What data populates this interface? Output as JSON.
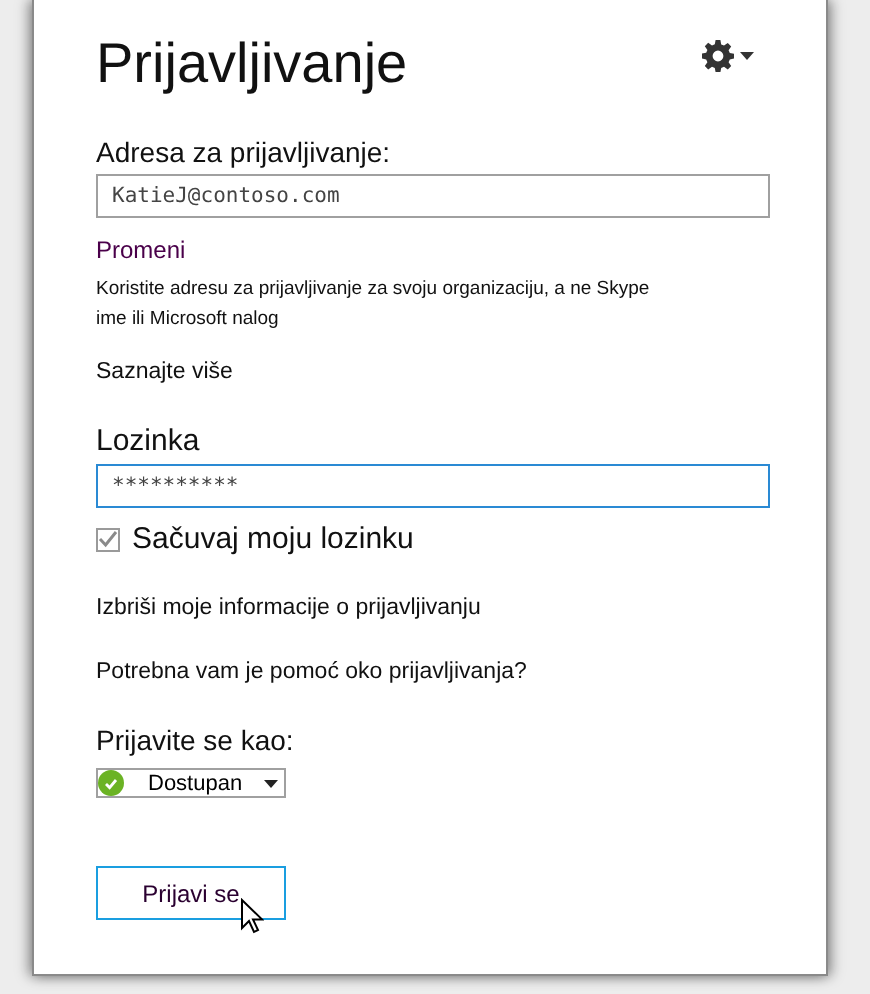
{
  "title": "Prijavljivanje",
  "address": {
    "label": "Adresa za prijavljivanje:",
    "value": "KatieJ@contoso.com"
  },
  "change_link": "Promeni",
  "hint": "Koristite adresu za prijavljivanje za svoju organizaciju, a ne Skype ime ili Microsoft nalog",
  "learn_more": "Saznajte više",
  "password": {
    "label": "Lozinka",
    "value": "**********"
  },
  "save_password": {
    "label": "Sačuvaj moju lozinku",
    "checked": true
  },
  "delete_info": "Izbriši moje informacije o prijavljivanju",
  "help": "Potrebna vam je pomoć oko prijavljivanja?",
  "sign_in_as": {
    "label": "Prijavite se kao:",
    "status": "Dostupan",
    "color": "#6bb324"
  },
  "sign_in_button": "Prijavi se"
}
